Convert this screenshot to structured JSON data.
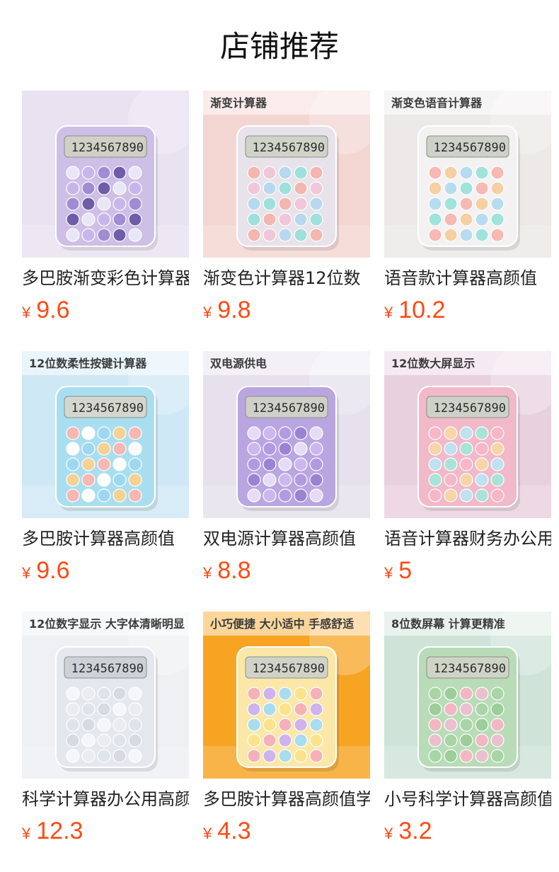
{
  "page_title": "店铺推荐",
  "currency_symbol": "¥",
  "products": [
    {
      "name": "多巴胺渐变彩色计算器",
      "price": "9.6",
      "image_caption": "",
      "palette": {
        "bg": "#e9e2f1",
        "body": "#cdbfe6",
        "screen": "#cfd0c6",
        "keys": [
          "#e9e6f5",
          "#c7b6ea",
          "#a08cd3",
          "#6f5da8"
        ]
      }
    },
    {
      "name": "渐变色计算器12位数",
      "price": "9.8",
      "image_caption": "渐变计算器",
      "palette": {
        "bg": "#f3d6d2",
        "body": "#e8e2ea",
        "screen": "#cfd3c8",
        "keys": [
          "#f4b6b0",
          "#f0c7d8",
          "#b7d8ef",
          "#9fe0dc"
        ]
      }
    },
    {
      "name": "语音款计算器高颜值",
      "price": "10.2",
      "image_caption": "渐变色语音计算器",
      "palette": {
        "bg": "#ece9e8",
        "body": "#f4f1f2",
        "screen": "#cdd1c7",
        "keys": [
          "#f6b9b3",
          "#f4d0a3",
          "#b7dcef",
          "#9fe3dc"
        ]
      }
    },
    {
      "name": "多巴胺计算器高颜值",
      "price": "9.6",
      "image_caption": "12位数柔性按键计算器",
      "palette": {
        "bg": "#cfe8f6",
        "body": "#a9def0",
        "screen": "#d5d7cf",
        "keys": [
          "#f7b7b2",
          "#ffffff",
          "#9fd7f3",
          "#f5d193"
        ]
      }
    },
    {
      "name": "双电源计算器高颜值",
      "price": "8.8",
      "image_caption": "双电源供电",
      "palette": {
        "bg": "#e6e1ec",
        "body": "#b9a6e0",
        "screen": "#cfd0c8",
        "keys": [
          "#e7dcf7",
          "#cdb7ee",
          "#b39ae0",
          "#9b83d2"
        ]
      }
    },
    {
      "name": "语音计算器财务办公用",
      "price": "5",
      "image_caption": "12位数大屏显示",
      "palette": {
        "bg": "#e9d0df",
        "body": "#f1b9c9",
        "screen": "#cdd2c9",
        "keys": [
          "#f7b7c7",
          "#f8d5a7",
          "#bfe1f0",
          "#a9e3d8"
        ]
      }
    },
    {
      "name": "科学计算器办公用高颜值",
      "price": "12.3",
      "image_caption": "12位数字显示 大字体清晰明显",
      "palette": {
        "bg": "#eef0f3",
        "body": "#e4e8ee",
        "screen": "#cdd2d8",
        "keys": [
          "#f4f6f9",
          "#e9ecf1",
          "#dfe4ea",
          "#d6dbe2"
        ]
      }
    },
    {
      "name": "多巴胺计算器高颜值学生",
      "price": "4.3",
      "image_caption": "小巧便捷 大小适中 手感舒适",
      "palette": {
        "bg": "#f7a422",
        "body": "#fbe8a8",
        "screen": "#d0d4c8",
        "keys": [
          "#f6b1b8",
          "#cfb3ee",
          "#a9dcef",
          "#fbe38b"
        ]
      }
    },
    {
      "name": "小号科学计算器高颜值",
      "price": "3.2",
      "image_caption": "8位数屏幕 计算更精准",
      "palette": {
        "bg": "#cfe3d9",
        "body": "#b8dcb7",
        "screen": "#cfd5c6",
        "keys": [
          "#a9d4a7",
          "#9ccd9a",
          "#f3b6c3",
          "#ebc0ce"
        ]
      }
    }
  ]
}
